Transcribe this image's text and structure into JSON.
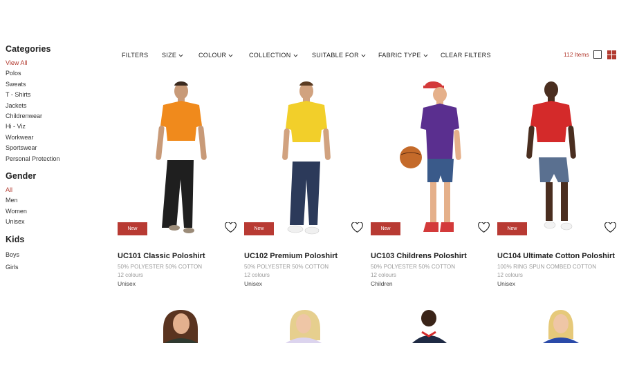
{
  "sidebar": {
    "categories": {
      "heading": "Categories",
      "items": [
        "View All",
        "Polos",
        "Sweats",
        "T - Shirts",
        "Jackets",
        "Childrenwear",
        "Hi - Viz",
        "Workwear",
        "Sportswear",
        "Personal Protection"
      ],
      "active_index": 0
    },
    "gender": {
      "heading": "Gender",
      "items": [
        "All",
        "Men",
        "Women",
        "Unisex"
      ],
      "active_index": 0
    },
    "kids": {
      "heading": "Kids",
      "items": [
        "Boys",
        "Girls"
      ]
    }
  },
  "toolbar": {
    "filters": "FILTERS",
    "size": "SIZE",
    "colour": "COLOUR",
    "collection": "COLLECTION",
    "suitable_for": "SUITABLE FOR",
    "fabric_type": "FABRIC TYPE",
    "clear_filters": "CLEAR FILTERS",
    "item_count": "112 Items"
  },
  "colors": {
    "accent": "#b23a2f",
    "badge": "#b83a33"
  },
  "products": [
    {
      "badge": "New",
      "title": "UC101 Classic Poloshirt",
      "fabric": "50% POLYESTER 50% COTTON",
      "colours": "12 colours",
      "gender": "Unisex",
      "shirt_color": "#f08a1c"
    },
    {
      "badge": "New",
      "title": "UC102 Premium Poloshirt",
      "fabric": "50% POLYESTER 50% COTTON",
      "colours": "12 colours",
      "gender": "Unisex",
      "shirt_color": "#f2cf2a"
    },
    {
      "badge": "New",
      "title": "UC103 Childrens Poloshirt",
      "fabric": "50% POLYESTER 50% COTTON",
      "colours": "12 colours",
      "gender": "Children",
      "shirt_color": "#5a2f8f"
    },
    {
      "badge": "New",
      "title": "UC104 Ultimate Cotton Poloshirt",
      "fabric": "100% RING SPUN COMBED COTTON",
      "colours": "12 colours",
      "gender": "Unisex",
      "shirt_color": "#d42a2a"
    }
  ]
}
